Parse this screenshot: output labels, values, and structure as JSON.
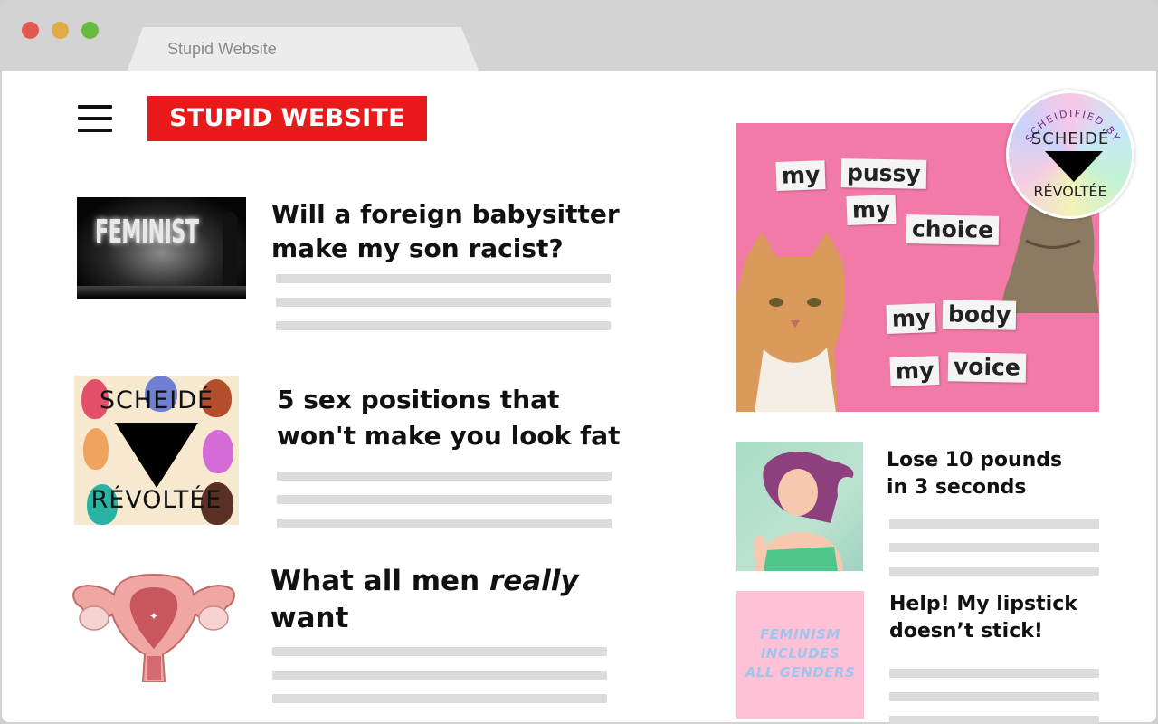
{
  "browser": {
    "tab_title": "Stupid Website"
  },
  "site": {
    "logo": "STUPID WEBSITE"
  },
  "articles_left": [
    {
      "title_line1": "Will a foreign babysitter",
      "title_line2": "make my son racist?",
      "thumb_text": "FEMINIST"
    },
    {
      "title_line1": "5 sex positions that",
      "title_line2": "won't make you look fat",
      "thumb_text_top": "SCHEIDÉ",
      "thumb_text_bottom": "RÉVOLTÉE"
    },
    {
      "title_part1": "What all men ",
      "title_em": "really",
      "title_line2": "want"
    }
  ],
  "feature_image": {
    "words": [
      "my",
      "pussy",
      "my",
      "choice",
      "my",
      "body",
      "my",
      "voice"
    ]
  },
  "badge": {
    "ring_text": "SCHEIDIFIED BY",
    "top": "SCHEIDÉ",
    "bottom": "RÉVOLTÉE"
  },
  "articles_right": [
    {
      "title_line1": "Lose 10 pounds",
      "title_line2": "in 3 seconds"
    },
    {
      "title_line1": "Help! My lipstick",
      "title_line2": "doesn’t stick!",
      "thumb_lines": [
        "FEMINISM",
        "INCLUDES",
        "ALL GENDERS"
      ]
    }
  ]
}
